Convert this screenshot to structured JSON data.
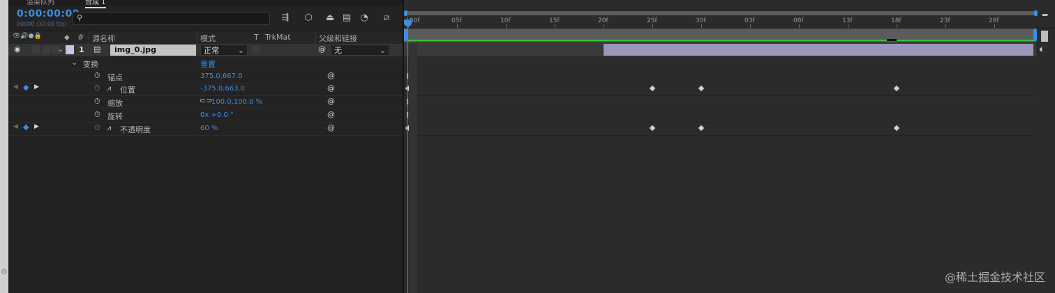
{
  "tabs": [
    "渲染队列",
    "合成 1"
  ],
  "timecode": "0:00:00:00",
  "fps": "00000 (32.00 fps)",
  "columns": {
    "eye_label": "👁",
    "number_label": "#",
    "source_name": "源名称",
    "mode": "模式",
    "track_t": "T",
    "trkmat": "TrkMat",
    "parent": "父级和链接"
  },
  "layer": {
    "index": "1",
    "name": "img_0.jpg",
    "mode": "正常",
    "parent": "无"
  },
  "transform": {
    "label": "变换",
    "reset": "重置",
    "props": [
      {
        "name": "锚点",
        "value": "375.0,667.0"
      },
      {
        "name": "位置",
        "value": "-375.0,663.0"
      },
      {
        "name": "缩放",
        "value": "100.0,100.0 %"
      },
      {
        "name": "旋转",
        "value": "0x +0.0 °"
      },
      {
        "name": "不透明度",
        "value": "60 %"
      }
    ]
  },
  "ruler_ticks": [
    "00f",
    "05f",
    "10f",
    "15f",
    "20f",
    "25f",
    "30f",
    "03f",
    "08f",
    "13f",
    "18f",
    "23f",
    "28f"
  ],
  "watermark": "@稀土掘金技术社区",
  "colors": {
    "accent": "#3a8ee6",
    "layer_bar": "#9a97bb",
    "green": "#3fbf3f"
  }
}
